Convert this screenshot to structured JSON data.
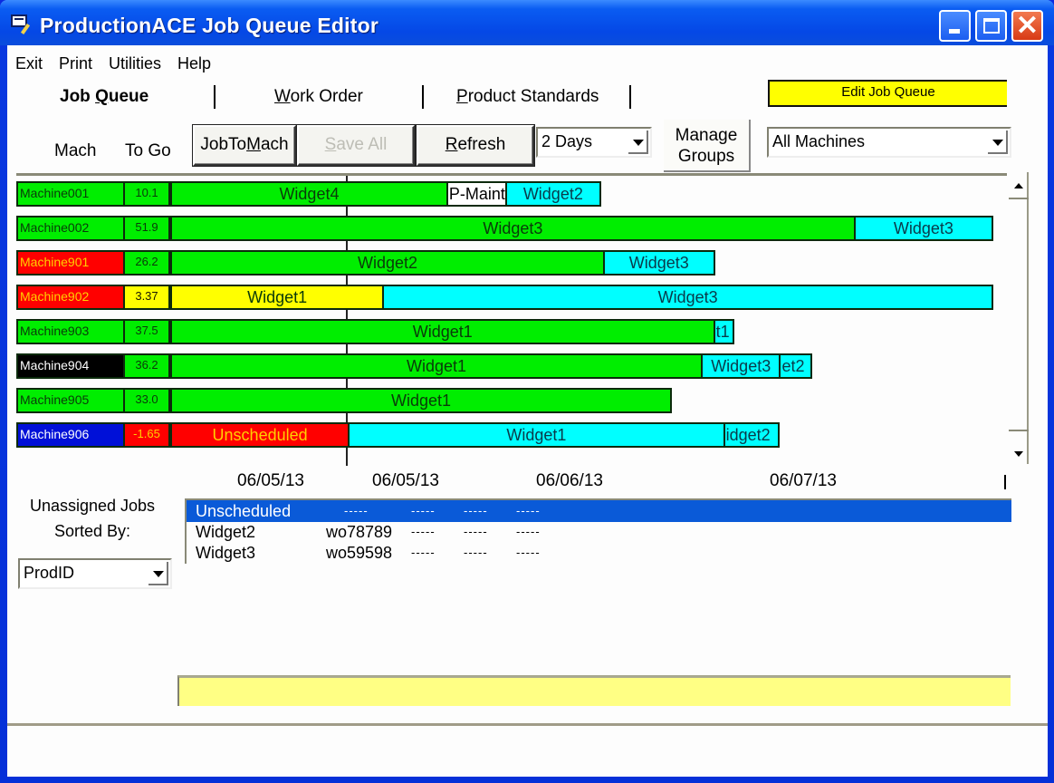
{
  "window": {
    "title": "ProductionACE Job Queue Editor",
    "controls": {
      "minimize": "_",
      "maximize": "□",
      "close": "✕"
    }
  },
  "menu": [
    "Exit",
    "Print",
    "Utilities",
    "Help"
  ],
  "tabs": [
    {
      "label_pre": "Job ",
      "label_acc": "Q",
      "label_post": "ueue",
      "active": true
    },
    {
      "label_pre": "",
      "label_acc": "W",
      "label_post": "ork Order",
      "active": false
    },
    {
      "label_pre": "",
      "label_acc": "P",
      "label_post": "roduct Standards",
      "active": false
    }
  ],
  "mode_badge": {
    "label": "Edit Job Queue",
    "color": "#ffff00"
  },
  "columns": {
    "mach": "Mach",
    "togo": "To Go"
  },
  "toolbar": {
    "job_to_mach": {
      "pre": "JobTo",
      "acc": "M",
      "post": "ach"
    },
    "save_all": {
      "pre": "",
      "acc": "S",
      "post": "ave All",
      "disabled": true
    },
    "refresh": {
      "pre": "",
      "acc": "R",
      "post": "efresh"
    },
    "range_select": "2 Days",
    "manage_groups_line1": "Manage",
    "manage_groups_line2": "Groups",
    "machine_filter": "All Machines"
  },
  "colors": {
    "green": "#00ee00",
    "cyan": "#00ffff",
    "yellow": "#ffff00",
    "red": "#ff0000",
    "black": "#000000",
    "blue": "#0010d8",
    "white": "#ffffff"
  },
  "machines": [
    {
      "name": "Machine001",
      "name_bg": "green",
      "name_color": "#0a3a0a",
      "togo": "10.1",
      "togo_bg": "green",
      "togo_color": "#0a3a0a",
      "jobs": [
        {
          "label": "Widget4",
          "color": "green",
          "start": 0.0,
          "end": 0.3362
        },
        {
          "label": "P-Maint",
          "color": "white",
          "start": 0.3362,
          "end": 0.4077,
          "clip": true
        },
        {
          "label": "Widget2",
          "color": "cyan",
          "start": 0.4077,
          "end": 0.5225
        }
      ]
    },
    {
      "name": "Machine002",
      "name_bg": "green",
      "name_color": "#0a3a0a",
      "togo": "51.9",
      "togo_bg": "green",
      "togo_color": "#0a3a0a",
      "jobs": [
        {
          "label": "Widget3",
          "color": "green",
          "start": 0.0,
          "end": 0.8322
        },
        {
          "label": "Widget3",
          "color": "cyan",
          "start": 0.8322,
          "end": 1.0
        }
      ]
    },
    {
      "name": "Machine901",
      "name_bg": "red",
      "name_color": "#ffd000",
      "togo": "26.2",
      "togo_bg": "green",
      "togo_color": "#0a3a0a",
      "jobs": [
        {
          "label": "Widget2",
          "color": "green",
          "start": 0.0,
          "end": 0.527
        },
        {
          "label": "Widget3",
          "color": "cyan",
          "start": 0.527,
          "end": 0.6611
        }
      ]
    },
    {
      "name": "Machine902",
      "name_bg": "red",
      "name_color": "#ffd000",
      "togo": "3.37",
      "togo_bg": "yellow",
      "togo_color": "#1a1a00",
      "jobs": [
        {
          "label": "Widget1",
          "color": "yellow",
          "start": 0.0,
          "end": 0.2583
        },
        {
          "label": "Widget3",
          "color": "cyan",
          "start": 0.2583,
          "end": 1.0
        }
      ]
    },
    {
      "name": "Machine903",
      "name_bg": "green",
      "name_color": "#0a3a0a",
      "togo": "37.5",
      "togo_bg": "green",
      "togo_color": "#0a3a0a",
      "jobs": [
        {
          "label": "Widget1",
          "color": "green",
          "start": 0.0,
          "end": 0.6611
        },
        {
          "label": "t1",
          "color": "cyan",
          "start": 0.6611,
          "end": 0.6846,
          "clip": true
        }
      ]
    },
    {
      "name": "Machine904",
      "name_bg": "black",
      "name_color": "#ffffff",
      "togo": "36.2",
      "togo_bg": "green",
      "togo_color": "#0a3a0a",
      "jobs": [
        {
          "label": "Widget1",
          "color": "green",
          "start": 0.0,
          "end": 0.6461
        },
        {
          "label": "Widget3",
          "color": "cyan",
          "start": 0.6461,
          "end": 0.7414
        },
        {
          "label": "et2",
          "color": "cyan",
          "start": 0.7414,
          "end": 0.78,
          "clip": true
        }
      ]
    },
    {
      "name": "Machine905",
      "name_bg": "green",
      "name_color": "#0a3a0a",
      "togo": "33.0",
      "togo_bg": "green",
      "togo_color": "#0a3a0a",
      "jobs": [
        {
          "label": "Widget1",
          "color": "green",
          "start": 0.0,
          "end": 0.6086
        }
      ]
    },
    {
      "name": "Machine906",
      "name_bg": "blue",
      "name_color": "#ffffff",
      "togo": "-1.65",
      "togo_bg": "red",
      "togo_color": "#ffd000",
      "jobs": [
        {
          "label": "Unscheduled",
          "color": "red",
          "start": 0.0,
          "end": 0.2163,
          "text_color": "#ffd000"
        },
        {
          "label": "Widget1",
          "color": "cyan",
          "start": 0.2163,
          "end": 0.6732
        },
        {
          "label": "idget2",
          "color": "cyan",
          "start": 0.6732,
          "end": 0.7401,
          "clip": true
        }
      ]
    }
  ],
  "timeline": {
    "dates": [
      "06/05/13",
      "06/05/13",
      "06/06/13",
      "06/07/13"
    ]
  },
  "unassigned": {
    "label_line1": "Unassigned Jobs",
    "label_line2": "Sorted By:",
    "sort_by": "ProdID",
    "rows": [
      {
        "product": "Unscheduled",
        "work_order": "",
        "cols": [
          "-----",
          "-----",
          "-----",
          "-----"
        ],
        "selected": true
      },
      {
        "product": "Widget2",
        "work_order": "wo78789",
        "cols": [
          "-----",
          "-----",
          "-----"
        ],
        "selected": false
      },
      {
        "product": "Widget3",
        "work_order": "wo59598",
        "cols": [
          "-----",
          "-----",
          "-----"
        ],
        "selected": false
      }
    ]
  },
  "status_message": ""
}
